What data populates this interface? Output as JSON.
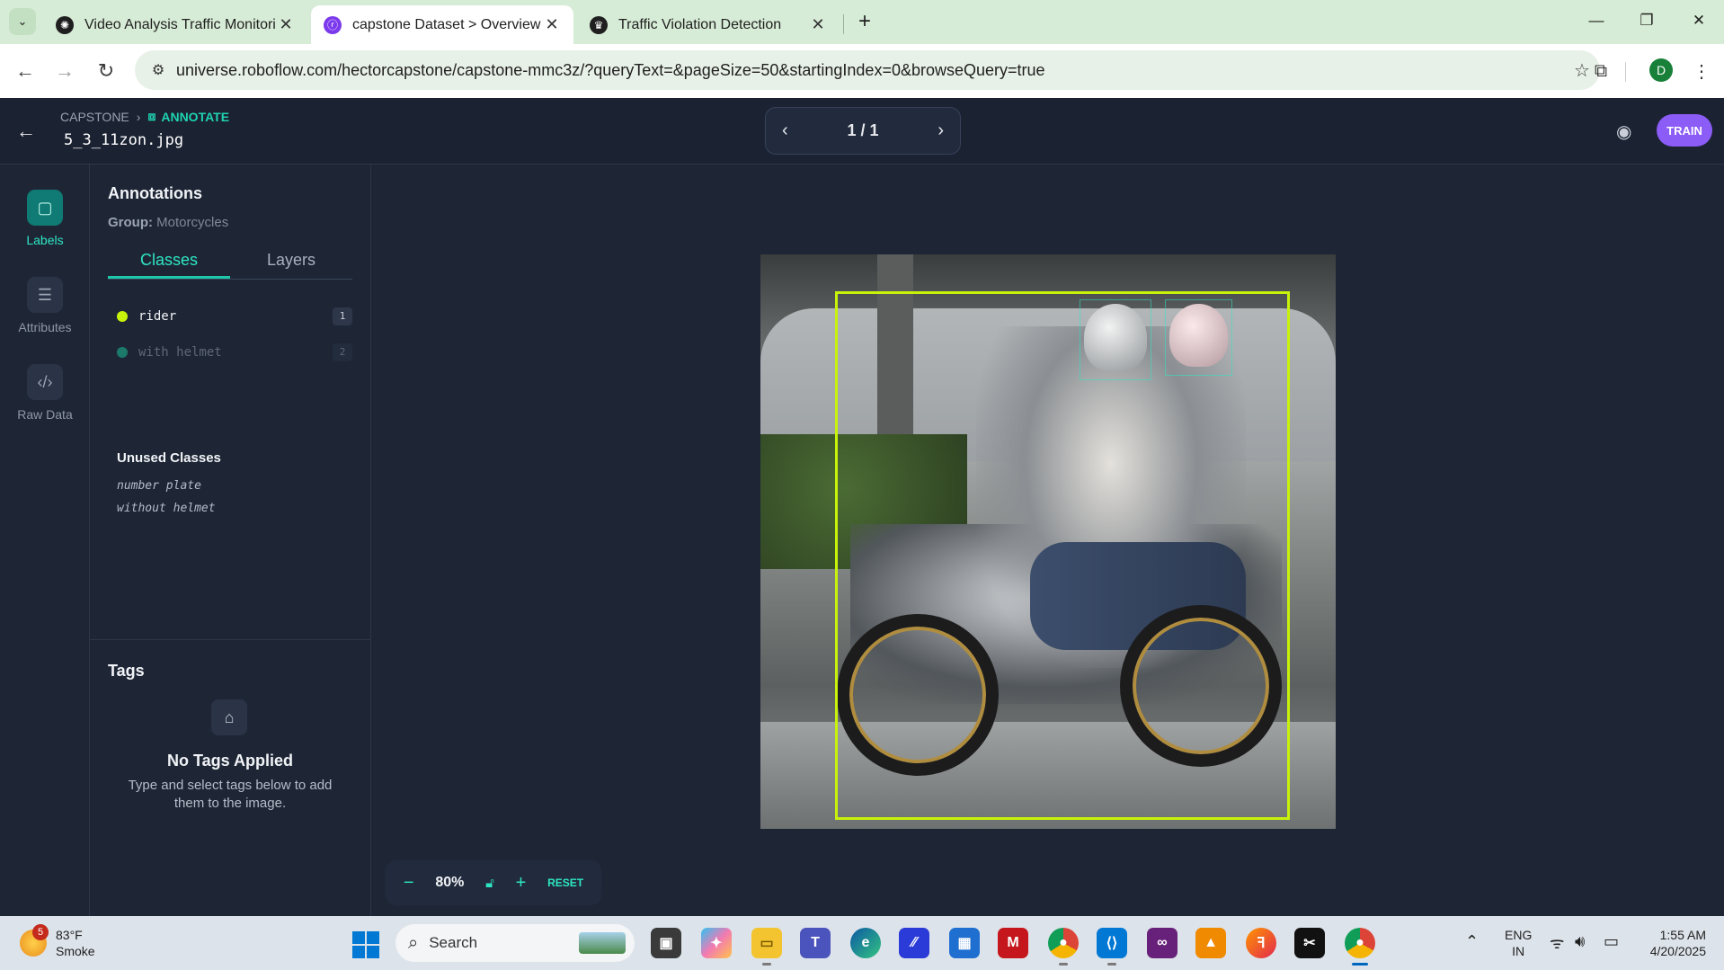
{
  "browser": {
    "tabs": [
      {
        "title": "Video Analysis Traffic Monitorin",
        "active": false
      },
      {
        "title": "capstone Dataset > Overview",
        "active": true
      },
      {
        "title": "Traffic Violation Detection",
        "active": false
      }
    ],
    "url": "universe.roboflow.com/hectorcapstone/capstone-mmc3z/?queryText=&pageSize=50&startingIndex=0&browseQuery=true",
    "profile_initial": "D"
  },
  "header": {
    "breadcrumb_project": "CAPSTONE",
    "breadcrumb_section": "ANNOTATE",
    "filename": "5_3_11zon.jpg",
    "pager": "1 / 1",
    "train_label": "TRAIN"
  },
  "rail": {
    "labels": "Labels",
    "attributes": "Attributes",
    "raw_data": "Raw Data"
  },
  "annotations": {
    "title": "Annotations",
    "group_label": "Group:",
    "group_value": "Motorcycles",
    "tab_classes": "Classes",
    "tab_layers": "Layers",
    "classes": [
      {
        "name": "rider",
        "count": "1",
        "color": "#c8f20a",
        "muted": false
      },
      {
        "name": "with helmet",
        "count": "2",
        "color": "#1c7a6a",
        "muted": true
      }
    ],
    "unused_title": "Unused Classes",
    "unused": [
      "number plate",
      "without helmet"
    ]
  },
  "tags": {
    "title": "Tags",
    "empty_title": "No Tags Applied",
    "empty_hint": "Type and select tags below to add them to the image."
  },
  "zoom": {
    "percent": "80%",
    "reset": "RESET"
  },
  "taskbar": {
    "weather_temp": "83°F",
    "weather_desc": "Smoke",
    "weather_badge": "5",
    "search_placeholder": "Search",
    "lang_line1": "ENG",
    "lang_line2": "IN",
    "time": "1:55 AM",
    "date": "4/20/2025"
  },
  "colors": {
    "accent": "#2ee6c4",
    "bbox": "#c8f20a",
    "train": "#8b5cf6"
  }
}
